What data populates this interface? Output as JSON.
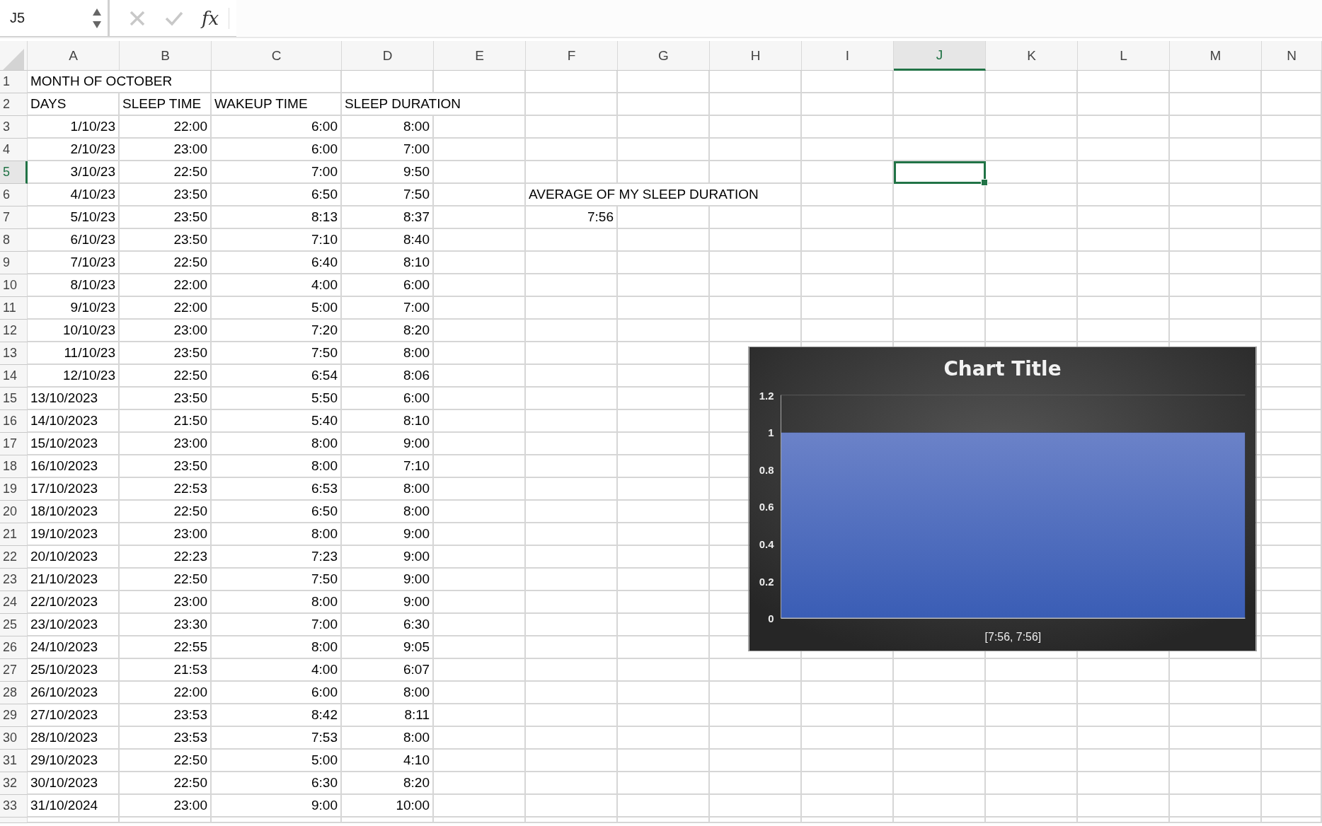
{
  "formula_bar": {
    "name_box": "J5",
    "function_label": "fx"
  },
  "columns": [
    {
      "label": "A",
      "selected": false
    },
    {
      "label": "B",
      "selected": false
    },
    {
      "label": "C",
      "selected": false
    },
    {
      "label": "D",
      "selected": false
    },
    {
      "label": "E",
      "selected": false
    },
    {
      "label": "F",
      "selected": false
    },
    {
      "label": "G",
      "selected": false
    },
    {
      "label": "H",
      "selected": false
    },
    {
      "label": "I",
      "selected": false
    },
    {
      "label": "J",
      "selected": true
    },
    {
      "label": "K",
      "selected": false
    },
    {
      "label": "L",
      "selected": false
    },
    {
      "label": "M",
      "selected": false
    },
    {
      "label": "N",
      "selected": false
    }
  ],
  "rows": [
    {
      "number": "1",
      "selected": false,
      "cells": [
        {
          "text": "MONTH OF OCTOBER",
          "kind": "text"
        }
      ]
    },
    {
      "number": "2",
      "selected": false,
      "cells": [
        {
          "text": "DAYS",
          "kind": "text"
        },
        {
          "text": "SLEEP TIME",
          "kind": "text"
        },
        {
          "text": "WAKEUP TIME",
          "kind": "text"
        },
        {
          "text": "SLEEP DURATION",
          "kind": "text"
        }
      ]
    },
    {
      "number": "3",
      "selected": false,
      "cells": [
        {
          "text": "1/10/23",
          "kind": "number"
        },
        {
          "text": "22:00",
          "kind": "number"
        },
        {
          "text": "6:00",
          "kind": "number"
        },
        {
          "text": "8:00",
          "kind": "number"
        }
      ]
    },
    {
      "number": "4",
      "selected": false,
      "cells": [
        {
          "text": "2/10/23",
          "kind": "number"
        },
        {
          "text": "23:00",
          "kind": "number"
        },
        {
          "text": "6:00",
          "kind": "number"
        },
        {
          "text": "7:00",
          "kind": "number"
        }
      ]
    },
    {
      "number": "5",
      "selected": true,
      "cells": [
        {
          "text": "3/10/23",
          "kind": "number"
        },
        {
          "text": "22:50",
          "kind": "number"
        },
        {
          "text": "7:00",
          "kind": "number"
        },
        {
          "text": "9:50",
          "kind": "number"
        }
      ]
    },
    {
      "number": "6",
      "selected": false,
      "cells": [
        {
          "text": "4/10/23",
          "kind": "number"
        },
        {
          "text": "23:50",
          "kind": "number"
        },
        {
          "text": "6:50",
          "kind": "number"
        },
        {
          "text": "7:50",
          "kind": "number"
        }
      ]
    },
    {
      "number": "7",
      "selected": false,
      "cells": [
        {
          "text": "5/10/23",
          "kind": "number"
        },
        {
          "text": "23:50",
          "kind": "number"
        },
        {
          "text": "8:13",
          "kind": "number"
        },
        {
          "text": "8:37",
          "kind": "number"
        }
      ]
    },
    {
      "number": "8",
      "selected": false,
      "cells": [
        {
          "text": "6/10/23",
          "kind": "number"
        },
        {
          "text": "23:50",
          "kind": "number"
        },
        {
          "text": "7:10",
          "kind": "number"
        },
        {
          "text": "8:40",
          "kind": "number"
        }
      ]
    },
    {
      "number": "9",
      "selected": false,
      "cells": [
        {
          "text": "7/10/23",
          "kind": "number"
        },
        {
          "text": "22:50",
          "kind": "number"
        },
        {
          "text": "6:40",
          "kind": "number"
        },
        {
          "text": "8:10",
          "kind": "number"
        }
      ]
    },
    {
      "number": "10",
      "selected": false,
      "cells": [
        {
          "text": "8/10/23",
          "kind": "number"
        },
        {
          "text": "22:00",
          "kind": "number"
        },
        {
          "text": "4:00",
          "kind": "number"
        },
        {
          "text": "6:00",
          "kind": "number"
        }
      ]
    },
    {
      "number": "11",
      "selected": false,
      "cells": [
        {
          "text": "9/10/23",
          "kind": "number"
        },
        {
          "text": "22:00",
          "kind": "number"
        },
        {
          "text": "5:00",
          "kind": "number"
        },
        {
          "text": "7:00",
          "kind": "number"
        }
      ]
    },
    {
      "number": "12",
      "selected": false,
      "cells": [
        {
          "text": "10/10/23",
          "kind": "number"
        },
        {
          "text": "23:00",
          "kind": "number"
        },
        {
          "text": "7:20",
          "kind": "number"
        },
        {
          "text": "8:20",
          "kind": "number"
        }
      ]
    },
    {
      "number": "13",
      "selected": false,
      "cells": [
        {
          "text": "11/10/23",
          "kind": "number"
        },
        {
          "text": "23:50",
          "kind": "number"
        },
        {
          "text": "7:50",
          "kind": "number"
        },
        {
          "text": "8:00",
          "kind": "number"
        }
      ]
    },
    {
      "number": "14",
      "selected": false,
      "cells": [
        {
          "text": "12/10/23",
          "kind": "number"
        },
        {
          "text": "22:50",
          "kind": "number"
        },
        {
          "text": "6:54",
          "kind": "number"
        },
        {
          "text": "8:06",
          "kind": "number"
        }
      ]
    },
    {
      "number": "15",
      "selected": false,
      "cells": [
        {
          "text": "13/10/2023",
          "kind": "text"
        },
        {
          "text": "23:50",
          "kind": "number"
        },
        {
          "text": "5:50",
          "kind": "number"
        },
        {
          "text": "6:00",
          "kind": "number"
        }
      ]
    },
    {
      "number": "16",
      "selected": false,
      "cells": [
        {
          "text": "14/10/2023",
          "kind": "text"
        },
        {
          "text": "21:50",
          "kind": "number"
        },
        {
          "text": "5:40",
          "kind": "number"
        },
        {
          "text": "8:10",
          "kind": "number"
        }
      ]
    },
    {
      "number": "17",
      "selected": false,
      "cells": [
        {
          "text": "15/10/2023",
          "kind": "text"
        },
        {
          "text": "23:00",
          "kind": "number"
        },
        {
          "text": "8:00",
          "kind": "number"
        },
        {
          "text": "9:00",
          "kind": "number"
        }
      ]
    },
    {
      "number": "18",
      "selected": false,
      "cells": [
        {
          "text": "16/10/2023",
          "kind": "text"
        },
        {
          "text": "23:50",
          "kind": "number"
        },
        {
          "text": "8:00",
          "kind": "number"
        },
        {
          "text": "7:10",
          "kind": "number"
        }
      ]
    },
    {
      "number": "19",
      "selected": false,
      "cells": [
        {
          "text": "17/10/2023",
          "kind": "text"
        },
        {
          "text": "22:53",
          "kind": "number"
        },
        {
          "text": "6:53",
          "kind": "number"
        },
        {
          "text": "8:00",
          "kind": "number"
        }
      ]
    },
    {
      "number": "20",
      "selected": false,
      "cells": [
        {
          "text": "18/10/2023",
          "kind": "text"
        },
        {
          "text": "22:50",
          "kind": "number"
        },
        {
          "text": "6:50",
          "kind": "number"
        },
        {
          "text": "8:00",
          "kind": "number"
        }
      ]
    },
    {
      "number": "21",
      "selected": false,
      "cells": [
        {
          "text": "19/10/2023",
          "kind": "text"
        },
        {
          "text": "23:00",
          "kind": "number"
        },
        {
          "text": "8:00",
          "kind": "number"
        },
        {
          "text": "9:00",
          "kind": "number"
        }
      ]
    },
    {
      "number": "22",
      "selected": false,
      "cells": [
        {
          "text": "20/10/2023",
          "kind": "text"
        },
        {
          "text": "22:23",
          "kind": "number"
        },
        {
          "text": "7:23",
          "kind": "number"
        },
        {
          "text": "9:00",
          "kind": "number"
        }
      ]
    },
    {
      "number": "23",
      "selected": false,
      "cells": [
        {
          "text": "21/10/2023",
          "kind": "text"
        },
        {
          "text": "22:50",
          "kind": "number"
        },
        {
          "text": "7:50",
          "kind": "number"
        },
        {
          "text": "9:00",
          "kind": "number"
        }
      ]
    },
    {
      "number": "24",
      "selected": false,
      "cells": [
        {
          "text": "22/10/2023",
          "kind": "text"
        },
        {
          "text": "23:00",
          "kind": "number"
        },
        {
          "text": "8:00",
          "kind": "number"
        },
        {
          "text": "9:00",
          "kind": "number"
        }
      ]
    },
    {
      "number": "25",
      "selected": false,
      "cells": [
        {
          "text": "23/10/2023",
          "kind": "text"
        },
        {
          "text": "23:30",
          "kind": "number"
        },
        {
          "text": "7:00",
          "kind": "number"
        },
        {
          "text": "6:30",
          "kind": "number"
        }
      ]
    },
    {
      "number": "26",
      "selected": false,
      "cells": [
        {
          "text": "24/10/2023",
          "kind": "text"
        },
        {
          "text": "22:55",
          "kind": "number"
        },
        {
          "text": "8:00",
          "kind": "number"
        },
        {
          "text": "9:05",
          "kind": "number"
        }
      ]
    },
    {
      "number": "27",
      "selected": false,
      "cells": [
        {
          "text": "25/10/2023",
          "kind": "text"
        },
        {
          "text": "21:53",
          "kind": "number"
        },
        {
          "text": "4:00",
          "kind": "number"
        },
        {
          "text": "6:07",
          "kind": "number"
        }
      ]
    },
    {
      "number": "28",
      "selected": false,
      "cells": [
        {
          "text": "26/10/2023",
          "kind": "text"
        },
        {
          "text": "22:00",
          "kind": "number"
        },
        {
          "text": "6:00",
          "kind": "number"
        },
        {
          "text": "8:00",
          "kind": "number"
        }
      ]
    },
    {
      "number": "29",
      "selected": false,
      "cells": [
        {
          "text": "27/10/2023",
          "kind": "text"
        },
        {
          "text": "23:53",
          "kind": "number"
        },
        {
          "text": "8:42",
          "kind": "number"
        },
        {
          "text": "8:11",
          "kind": "number"
        }
      ]
    },
    {
      "number": "30",
      "selected": false,
      "cells": [
        {
          "text": "28/10/2023",
          "kind": "text"
        },
        {
          "text": "23:53",
          "kind": "number"
        },
        {
          "text": "7:53",
          "kind": "number"
        },
        {
          "text": "8:00",
          "kind": "number"
        }
      ]
    },
    {
      "number": "31",
      "selected": false,
      "cells": [
        {
          "text": "29/10/2023",
          "kind": "text"
        },
        {
          "text": "22:50",
          "kind": "number"
        },
        {
          "text": "5:00",
          "kind": "number"
        },
        {
          "text": "4:10",
          "kind": "number"
        }
      ]
    },
    {
      "number": "32",
      "selected": false,
      "cells": [
        {
          "text": "30/10/2023",
          "kind": "text"
        },
        {
          "text": "22:50",
          "kind": "number"
        },
        {
          "text": "6:30",
          "kind": "number"
        },
        {
          "text": "8:20",
          "kind": "number"
        }
      ]
    },
    {
      "number": "33",
      "selected": false,
      "cells": [
        {
          "text": "31/10/2024",
          "kind": "text"
        },
        {
          "text": "23:00",
          "kind": "number"
        },
        {
          "text": "9:00",
          "kind": "number"
        },
        {
          "text": "10:00",
          "kind": "number"
        }
      ]
    }
  ],
  "summary": {
    "label": "AVERAGE OF MY SLEEP DURATION",
    "value": "7:56"
  },
  "chart": {
    "chart_data": {
      "type": "bar",
      "title": "Chart Title",
      "categories": [
        "[7:56, 7:56]"
      ],
      "values": [
        1
      ],
      "ylim": [
        0,
        1.2
      ],
      "yticks": [
        0,
        0.2,
        0.4,
        0.6,
        0.8,
        1,
        1.2
      ]
    }
  }
}
